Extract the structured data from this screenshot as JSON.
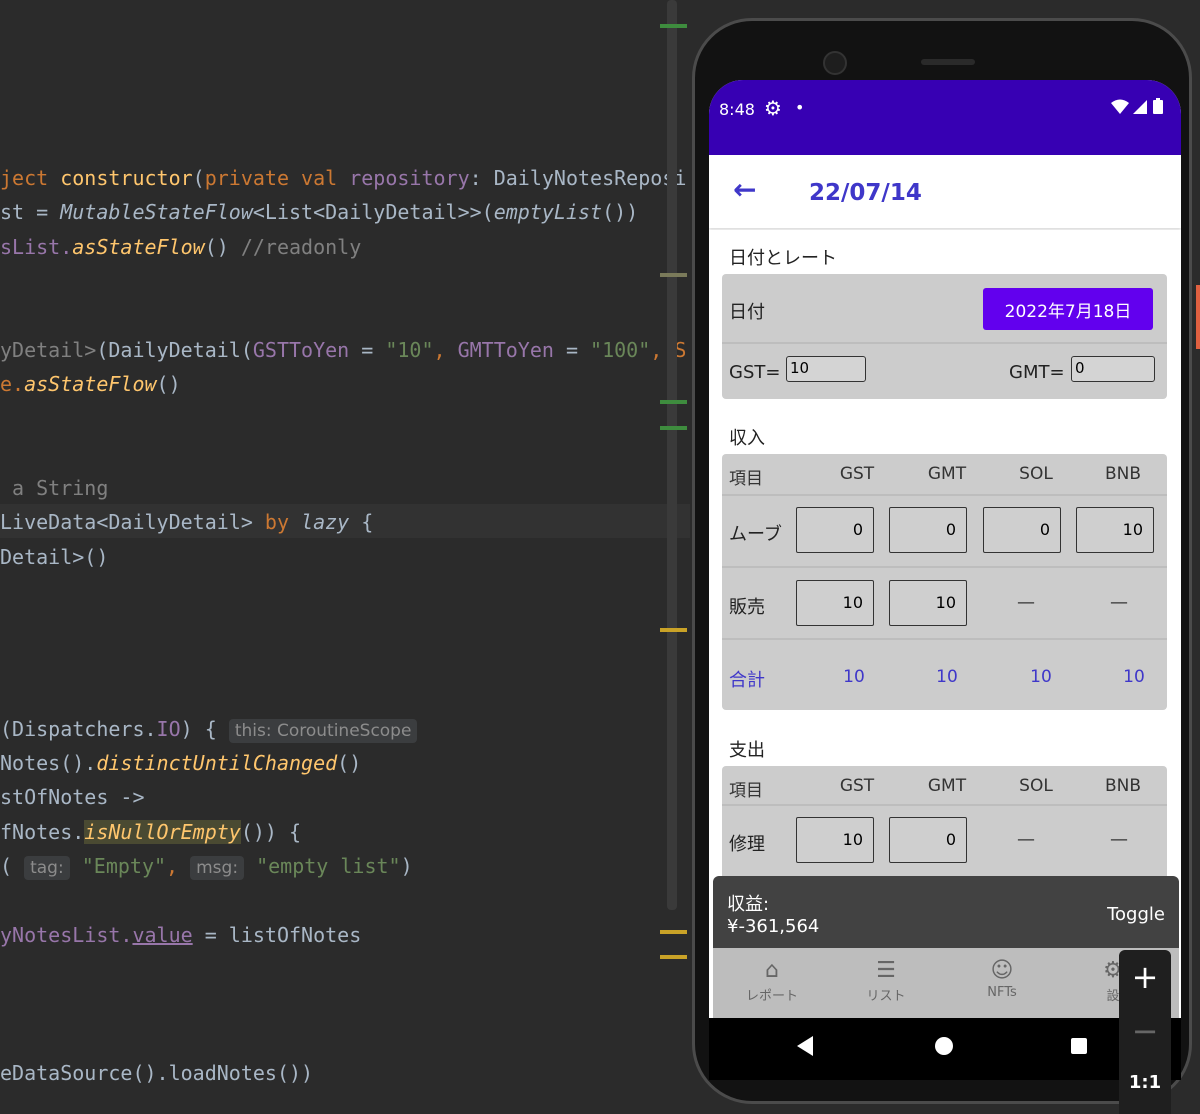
{
  "editor": {
    "lines": [
      {
        "parts": [
          {
            "t": "ject ",
            "c": "kw"
          },
          {
            "t": "constructor",
            "c": "fn2"
          },
          {
            "t": "(",
            "c": ""
          },
          {
            "t": "private val ",
            "c": "kw"
          },
          {
            "t": "repository",
            "c": "param"
          },
          {
            "t": ": DailyNotesReposi",
            "c": ""
          }
        ]
      },
      {
        "parts": [
          {
            "t": "st = ",
            "c": ""
          },
          {
            "t": "MutableStateFlow",
            "c": "it"
          },
          {
            "t": "<List<DailyDetail>>(",
            "c": ""
          },
          {
            "t": "emptyList",
            "c": "it"
          },
          {
            "t": "())",
            "c": ""
          }
        ]
      },
      {
        "parts": [
          {
            "t": "sList.",
            "c": "param"
          },
          {
            "t": "asStateFlow",
            "c": "fn"
          },
          {
            "t": "() ",
            "c": ""
          },
          {
            "t": "//readonly",
            "c": "cmt"
          }
        ]
      },
      {
        "parts": [
          {
            "t": "yDetail>",
            "c": "cmt"
          },
          {
            "t": "(DailyDetail(",
            "c": ""
          },
          {
            "t": "GSTToYen",
            "c": "param"
          },
          {
            "t": " = ",
            "c": ""
          },
          {
            "t": "\"10\"",
            "c": "str"
          },
          {
            "t": ", ",
            "c": "kw"
          },
          {
            "t": "GMTToYen",
            "c": "param"
          },
          {
            "t": " = ",
            "c": ""
          },
          {
            "t": "\"100\"",
            "c": "str"
          },
          {
            "t": ", S",
            "c": "kw"
          }
        ]
      },
      {
        "parts": [
          {
            "t": "e.",
            "c": "kw"
          },
          {
            "t": "asStateFlow",
            "c": "fn"
          },
          {
            "t": "()",
            "c": ""
          }
        ]
      },
      {
        "parts": [
          {
            "t": " a String",
            "c": "cmt"
          }
        ]
      },
      {
        "parts": [
          {
            "t": "LiveData",
            "c": "str"
          },
          {
            "t": "<DailyDetail> ",
            "c": ""
          },
          {
            "t": "by ",
            "c": "kw"
          },
          {
            "t": "lazy",
            "c": "it"
          },
          {
            "t": " {",
            "c": ""
          }
        ]
      },
      {
        "parts": [
          {
            "t": "Detail>()",
            "c": ""
          }
        ]
      },
      {
        "parts": [
          {
            "t": "(Dispatchers.",
            "c": ""
          },
          {
            "t": "IO",
            "c": "param"
          },
          {
            "t": ") { ",
            "c": ""
          },
          {
            "t": "this: CoroutineScope",
            "c": "hint"
          }
        ]
      },
      {
        "parts": [
          {
            "t": "Notes().",
            "c": ""
          },
          {
            "t": "distinctUntilChanged",
            "c": "fn"
          },
          {
            "t": "()",
            "c": ""
          }
        ]
      },
      {
        "parts": [
          {
            "t": "stOfNotes ->",
            "c": ""
          }
        ]
      },
      {
        "parts": [
          {
            "t": "fNotes.",
            "c": ""
          },
          {
            "t": "isNullOrEmpty",
            "c": "fnbox"
          },
          {
            "t": "()) {",
            "c": ""
          }
        ]
      },
      {
        "parts": [
          {
            "t": "( ",
            "c": ""
          },
          {
            "t": "tag:",
            "c": "hint"
          },
          {
            "t": " \"Empty\"",
            "c": "str"
          },
          {
            "t": ", ",
            "c": "kw"
          },
          {
            "t": "msg:",
            "c": "hint"
          },
          {
            "t": " \"empty list\"",
            "c": "str"
          },
          {
            "t": ")",
            "c": ""
          }
        ]
      },
      {
        "parts": [
          {
            "t": "yNotesList.",
            "c": "param"
          },
          {
            "t": "value",
            "c": "ul"
          },
          {
            "t": " = listOfNotes",
            "c": ""
          }
        ]
      },
      {
        "parts": [
          {
            "t": "eDataSource().loadNotes())",
            "c": ""
          }
        ]
      }
    ]
  },
  "status_bar": {
    "time": "8:48",
    "gear_icon": "gear-icon",
    "dot": "•",
    "icons": "▾◢▮"
  },
  "app_bar": {
    "back_icon": "←",
    "title": "22/07/14"
  },
  "date_rate": {
    "section_title": "日付とレート",
    "date_label": "日付",
    "date_button": "2022年7月18日",
    "gst_label": "GST=",
    "gst_value": "10",
    "gmt_label": "GMT=",
    "gmt_value": "0"
  },
  "income": {
    "section_title": "収入",
    "headers": [
      "項目",
      "GST",
      "GMT",
      "SOL",
      "BNB"
    ],
    "move_label": "ムーブ",
    "move_values": [
      "0",
      "0",
      "0",
      "10"
    ],
    "sale_label": "販売",
    "sale_values": [
      "10",
      "10"
    ],
    "sale_dashes": [
      "—",
      "—"
    ],
    "total_label": "合計",
    "totals": [
      "10",
      "10",
      "10",
      "10"
    ]
  },
  "expense": {
    "section_title": "支出",
    "headers": [
      "項目",
      "GST",
      "GMT",
      "SOL",
      "BNB"
    ],
    "repair_label": "修理",
    "repair_values": [
      "10",
      "0"
    ],
    "repair_dashes": [
      "—",
      "—"
    ]
  },
  "bottom_panel": {
    "label": "収益:",
    "value": "¥-361,564",
    "toggle": "Toggle"
  },
  "nav": {
    "items": [
      {
        "icon": "⌂",
        "label": "レポート"
      },
      {
        "icon": "☰",
        "label": "リスト"
      },
      {
        "icon": "☺",
        "label": "NFTs"
      },
      {
        "icon": "⚙",
        "label": "設"
      }
    ]
  },
  "zoom": {
    "plus": "+",
    "minus": "−",
    "ratio": "1:1"
  }
}
